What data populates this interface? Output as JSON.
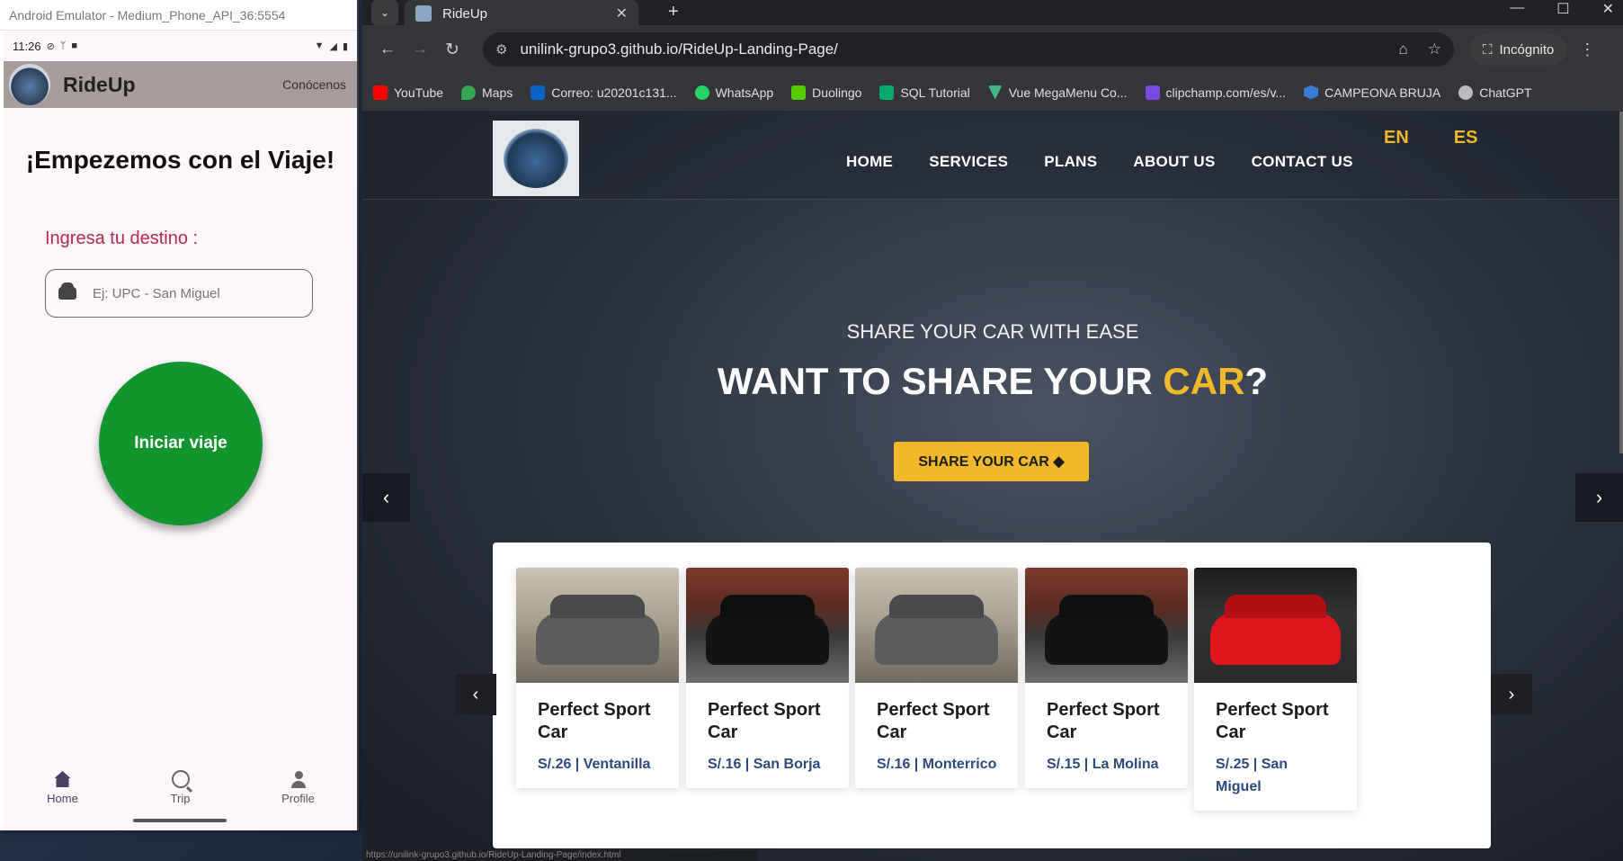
{
  "emulator": {
    "window_title": "Android Emulator - Medium_Phone_API_36:5554",
    "status_time": "11:26",
    "app_title": "RideUp",
    "app_link": "Conócenos",
    "heading": "¡Empezemos con el Viaje!",
    "destination_label": "Ingresa tu destino :",
    "destination_placeholder": "Ej: UPC - San Miguel",
    "start_button": "Iniciar viaje",
    "bottom_nav": [
      {
        "label": "Home",
        "icon": "home-icon",
        "active": true
      },
      {
        "label": "Trip",
        "icon": "trip-search-icon",
        "active": false
      },
      {
        "label": "Profile",
        "icon": "profile-icon",
        "active": false
      }
    ]
  },
  "browser": {
    "tab_title": "RideUp",
    "url": "unilink-grupo3.github.io/RideUp-Landing-Page/",
    "incognito_label": "Incógnito",
    "bookmarks": [
      {
        "label": "YouTube",
        "color": "#ff0000"
      },
      {
        "label": "Maps",
        "color": "#34a853"
      },
      {
        "label": "Correo: u20201c131...",
        "color": "#0a64c8"
      },
      {
        "label": "WhatsApp",
        "color": "#25d366"
      },
      {
        "label": "Duolingo",
        "color": "#58cc02"
      },
      {
        "label": "SQL Tutorial",
        "color": "#04aa6d"
      },
      {
        "label": "Vue MegaMenu Co...",
        "color": "#41b883"
      },
      {
        "label": "clipchamp.com/es/v...",
        "color": "#7b4ae2"
      },
      {
        "label": "CAMPEONA BRUJA",
        "color": "#3a7bd5"
      },
      {
        "label": "ChatGPT",
        "color": "#bbbbbb"
      }
    ],
    "status_url": "https://unilink-grupo3.github.io/RideUp-Landing-Page/index.html"
  },
  "site": {
    "nav": [
      "HOME",
      "SERVICES",
      "PLANS",
      "ABOUT US",
      "CONTACT US"
    ],
    "languages": [
      "EN",
      "ES"
    ],
    "hero_subtitle": "SHARE YOUR CAR WITH EASE",
    "hero_title_before": "WANT TO SHARE YOUR ",
    "hero_title_accent": "CAR",
    "hero_title_after": "?",
    "share_button": "SHARE YOUR CAR",
    "accent_color": "#f1b829",
    "cars": [
      {
        "name": "Perfect Sport Car",
        "price": "S/.26 | Ventanilla",
        "image": "silver-suv"
      },
      {
        "name": "Perfect Sport Car",
        "price": "S/.16 | San Borja",
        "image": "black-sedan"
      },
      {
        "name": "Perfect Sport Car",
        "price": "S/.16 | Monterrico",
        "image": "silver-suv"
      },
      {
        "name": "Perfect Sport Car",
        "price": "S/.15 | La Molina",
        "image": "black-sedan"
      },
      {
        "name": "Perfect Sport Car",
        "price": "S/.25 | San Miguel",
        "image": "red-sports"
      }
    ]
  }
}
